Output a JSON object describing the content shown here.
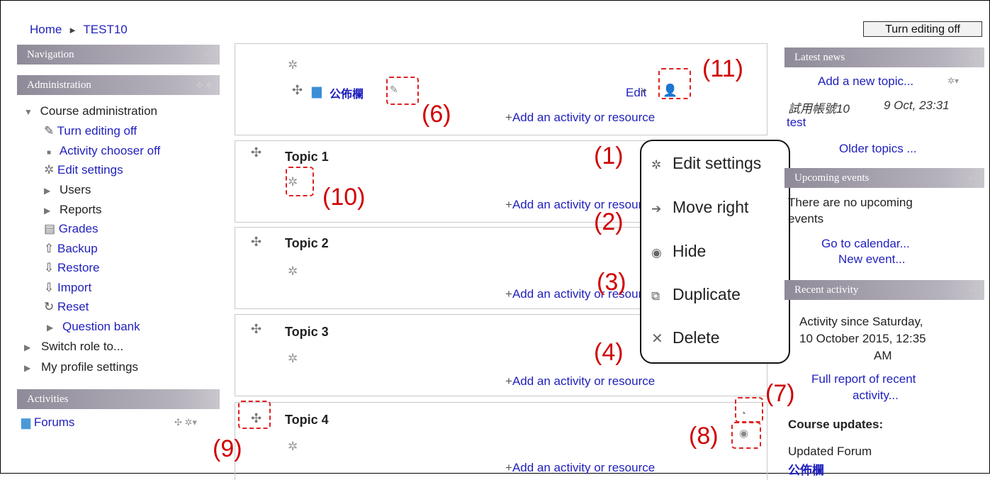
{
  "breadcrumb": {
    "home": "Home",
    "sep": "►",
    "course": "TEST10"
  },
  "editing_button": "Turn editing off",
  "left": {
    "navigation": "Navigation",
    "administration": "Administration",
    "course_admin": "Course administration",
    "items": {
      "turn_editing_off": "Turn editing off",
      "activity_chooser_off": "Activity chooser off",
      "edit_settings": "Edit settings",
      "users": "Users",
      "reports": "Reports",
      "grades": "Grades",
      "backup": "Backup",
      "restore": "Restore",
      "import": "Import",
      "reset": "Reset",
      "question_bank": "Question bank"
    },
    "switch_role": "Switch role to...",
    "profile_settings": "My profile settings",
    "activities": "Activities",
    "forums": "Forums"
  },
  "center": {
    "forum_name": "公佈欄",
    "edit_label": "Edit",
    "add_activity": "Add an activity or resource",
    "topics": [
      "Topic 1",
      "Topic 2",
      "Topic 3",
      "Topic 4"
    ]
  },
  "menu": {
    "edit_settings": "Edit settings",
    "move_right": "Move right",
    "hide": "Hide",
    "duplicate": "Duplicate",
    "delete": "Delete"
  },
  "annotations": [
    "(1)",
    "(2)",
    "(3)",
    "(4)",
    "(6)",
    "(7)",
    "(8)",
    "(9)",
    "(10)",
    "(11)"
  ],
  "right": {
    "latest_news": "Latest news",
    "add_topic": "Add a new topic...",
    "news_author": "試用帳號10",
    "news_date": "9 Oct, 23:31",
    "news_title": "test",
    "older_topics": "Older topics ...",
    "upcoming_events": "Upcoming events",
    "no_events_1": "There are no upcoming",
    "no_events_2": "events",
    "go_calendar": "Go to calendar...",
    "new_event": "New event...",
    "recent_activity": "Recent activity",
    "activity_since_1": "Activity since Saturday,",
    "activity_since_2": "10 October 2015, 12:35",
    "activity_since_3": "AM",
    "full_report_1": "Full report of recent",
    "full_report_2": "activity...",
    "course_updates": "Course updates:",
    "updated_forum": "Updated Forum",
    "updated_forum_name": "公佈欄"
  },
  "icons": {
    "gear": "gear-icon",
    "move": "move-icon",
    "forum": "forum-icon",
    "pencil": "pencil-icon",
    "person": "person-icon"
  }
}
